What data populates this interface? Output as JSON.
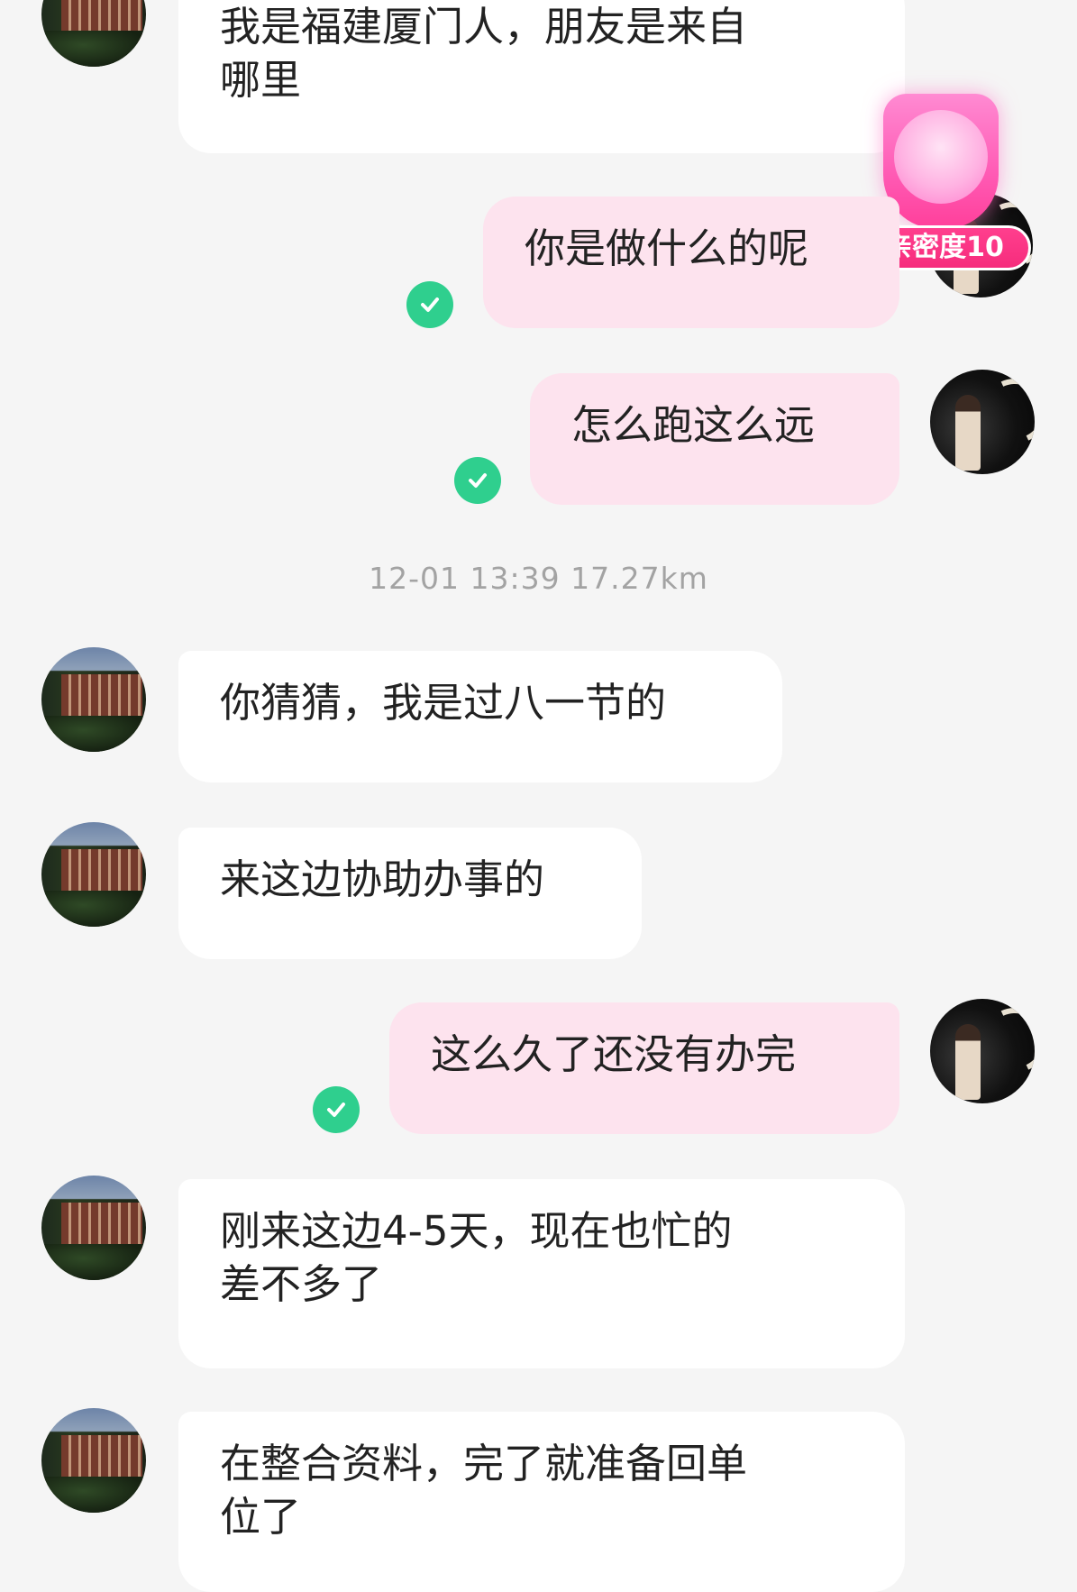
{
  "messages": {
    "m1": "我是福建厦门人，朋友是来自\n哪里",
    "m2": "你是做什么的呢",
    "m3": "怎么跑这么远",
    "timestamp": "12-01 13:39  17.27km",
    "m4": "你猜猜，我是过八一节的",
    "m5": "来这边协助办事的",
    "m6": "这么久了还没有办完",
    "m7": "刚来这边4-5天，现在也忙的\n差不多了",
    "m8": "在整合资料，完了就准备回单\n位了"
  },
  "badge": {
    "label": "亲密度10"
  },
  "colors": {
    "incoming_bubble": "#ffffff",
    "outgoing_bubble": "#fde3ee",
    "read_check": "#2fcf8e",
    "badge": "#f62c7c"
  },
  "icons": {
    "read": "check-icon",
    "intimacy": "heart-icon"
  }
}
